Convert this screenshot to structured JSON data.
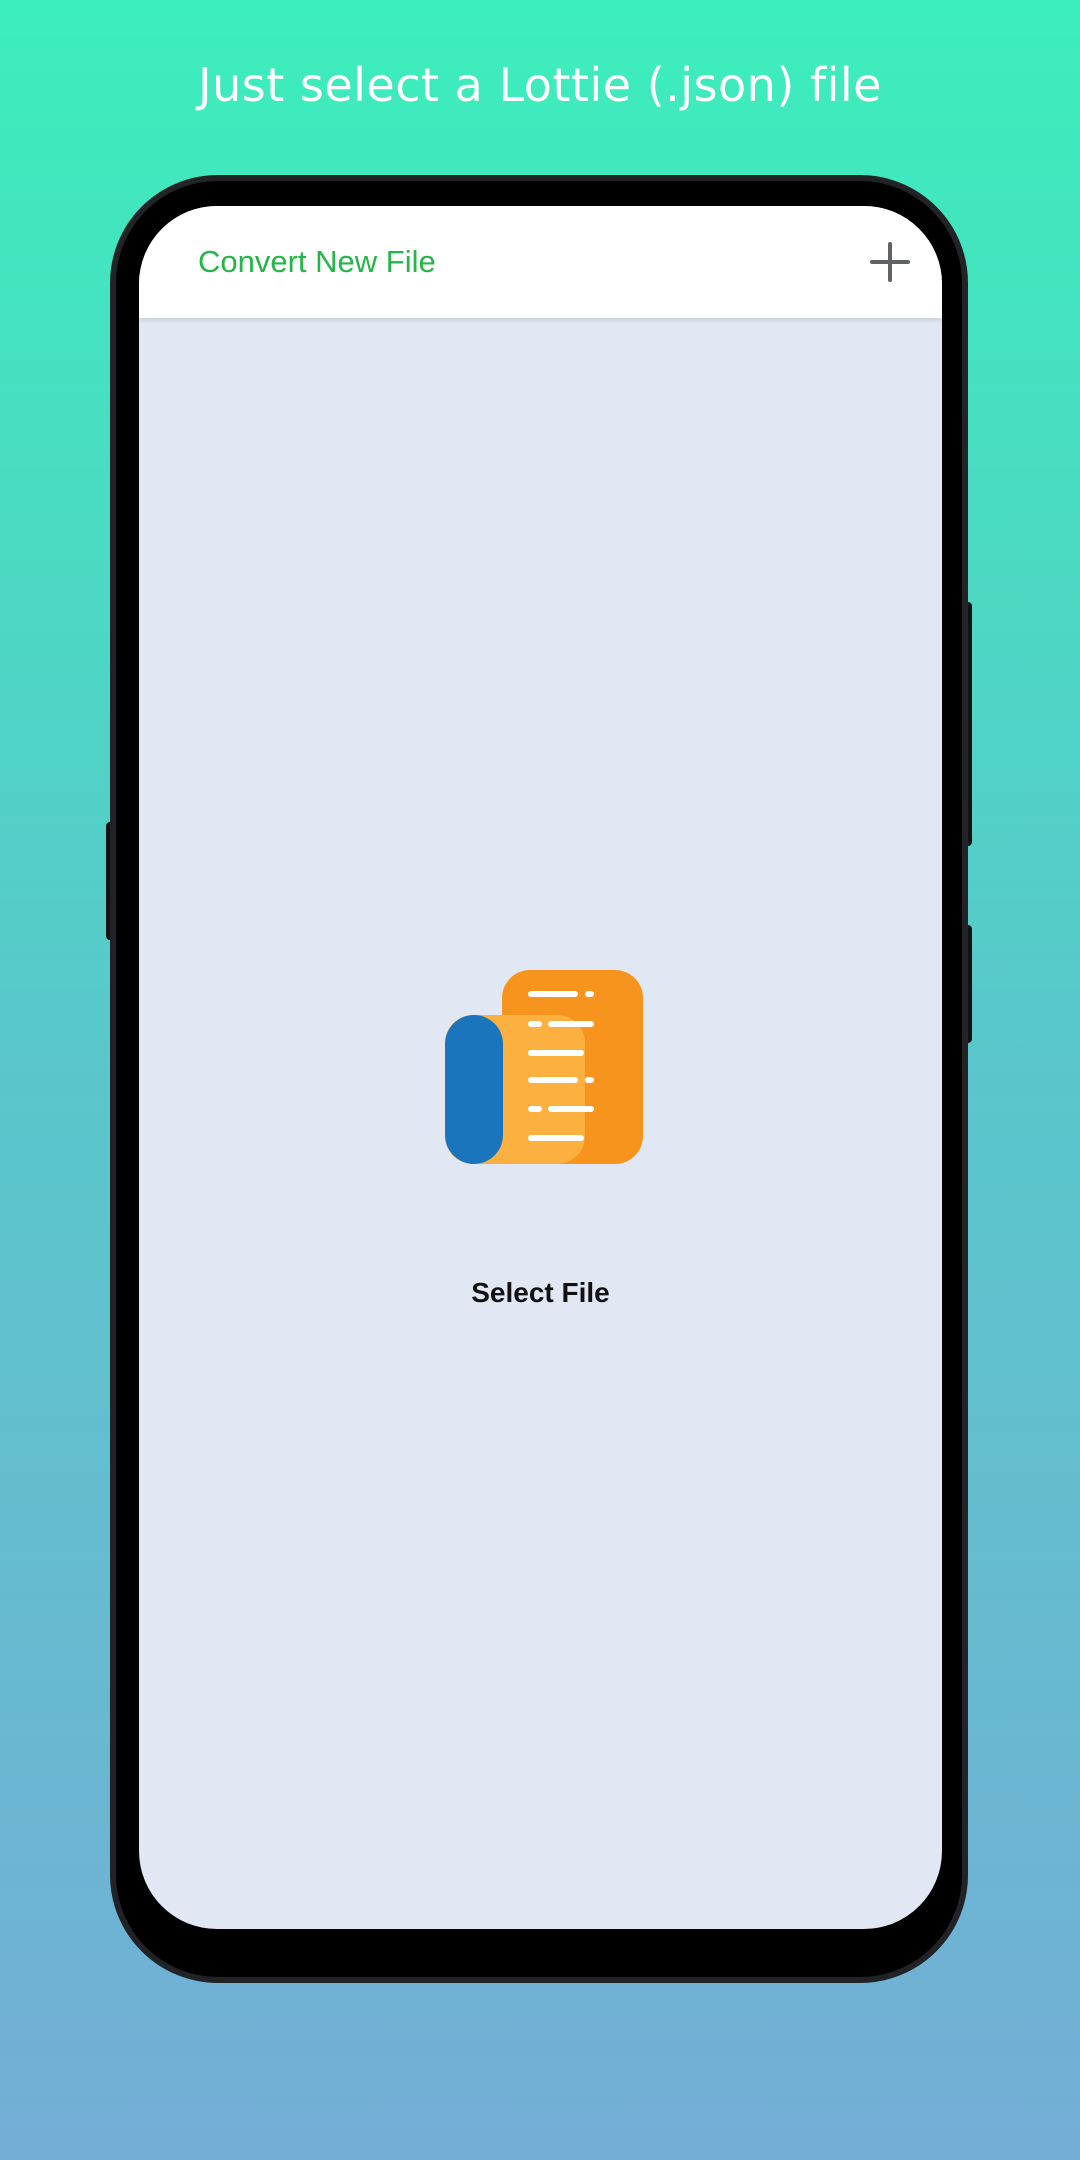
{
  "headline": "Just select a Lottie (.json) file",
  "appbar": {
    "title": "Convert New File",
    "add_icon": "plus-icon"
  },
  "main": {
    "file_icon": "document-scroll-icon",
    "select_label": "Select File"
  },
  "colors": {
    "title_green": "#25b548",
    "screen_bg": "#e1e8f4",
    "icon_blue": "#1b75bc",
    "icon_orange": "#f7941d",
    "icon_light_orange": "#fbb040"
  }
}
